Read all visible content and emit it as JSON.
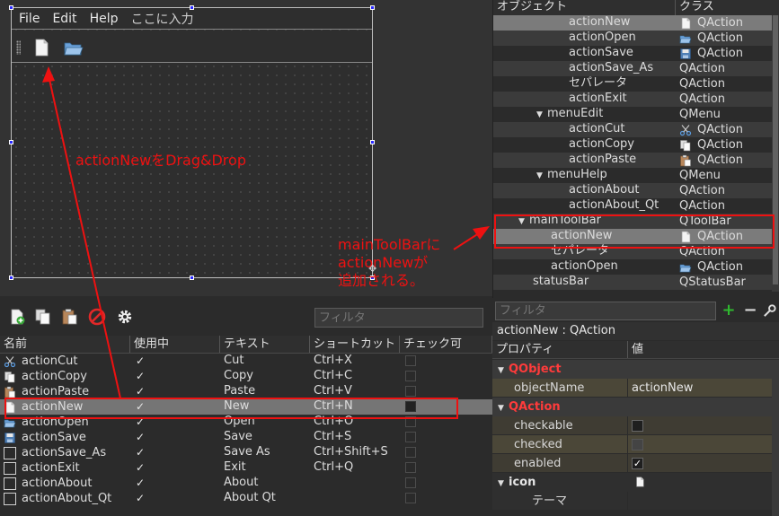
{
  "form": {
    "menus": [
      "File",
      "Edit",
      "Help",
      "ここに入力"
    ]
  },
  "action_editor": {
    "filter_placeholder": "フィルタ",
    "columns": [
      "名前",
      "使用中",
      "テキスト",
      "ショートカット",
      "チェック可"
    ],
    "rows": [
      {
        "name": "actionCut",
        "used": "✓",
        "text": "Cut",
        "shortcut": "Ctrl+X",
        "icon": "cut-icon"
      },
      {
        "name": "actionCopy",
        "used": "✓",
        "text": "Copy",
        "shortcut": "Ctrl+C",
        "icon": "copy-icon"
      },
      {
        "name": "actionPaste",
        "used": "✓",
        "text": "Paste",
        "shortcut": "Ctrl+V",
        "icon": "paste-icon"
      },
      {
        "name": "actionNew",
        "used": "✓",
        "text": "New",
        "shortcut": "Ctrl+N",
        "icon": "new-file-icon"
      },
      {
        "name": "actionOpen",
        "used": "✓",
        "text": "Open",
        "shortcut": "Ctrl+O",
        "icon": "open-folder-icon"
      },
      {
        "name": "actionSave",
        "used": "✓",
        "text": "Save",
        "shortcut": "Ctrl+S",
        "icon": "save-icon"
      },
      {
        "name": "actionSave_As",
        "used": "✓",
        "text": "Save As",
        "shortcut": "Ctrl+Shift+S",
        "icon": "blank-icon"
      },
      {
        "name": "actionExit",
        "used": "✓",
        "text": "Exit",
        "shortcut": "Ctrl+Q",
        "icon": "blank-icon"
      },
      {
        "name": "actionAbout",
        "used": "✓",
        "text": "About",
        "shortcut": "",
        "icon": "blank-icon"
      },
      {
        "name": "actionAbout_Qt",
        "used": "✓",
        "text": "About Qt",
        "shortcut": "",
        "icon": "blank-icon"
      }
    ]
  },
  "object_inspector": {
    "columns": [
      "オブジェクト",
      "クラス"
    ],
    "rows": [
      {
        "name": "actionNew",
        "class": "QAction",
        "icon": "new-file-icon"
      },
      {
        "name": "actionOpen",
        "class": "QAction",
        "icon": "open-folder-icon"
      },
      {
        "name": "actionSave",
        "class": "QAction",
        "icon": "save-icon"
      },
      {
        "name": "actionSave_As",
        "class": "QAction",
        "icon": ""
      },
      {
        "name": "セパレータ",
        "class": "QAction",
        "icon": ""
      },
      {
        "name": "actionExit",
        "class": "QAction",
        "icon": ""
      },
      {
        "name": "menuEdit",
        "class": "QMenu",
        "icon": ""
      },
      {
        "name": "actionCut",
        "class": "QAction",
        "icon": "cut-icon"
      },
      {
        "name": "actionCopy",
        "class": "QAction",
        "icon": "copy-icon"
      },
      {
        "name": "actionPaste",
        "class": "QAction",
        "icon": "paste-icon"
      },
      {
        "name": "menuHelp",
        "class": "QMenu",
        "icon": ""
      },
      {
        "name": "actionAbout",
        "class": "QAction",
        "icon": ""
      },
      {
        "name": "actionAbout_Qt",
        "class": "QAction",
        "icon": ""
      },
      {
        "name": "mainToolBar",
        "class": "QToolBar",
        "icon": ""
      },
      {
        "name": "actionNew",
        "class": "QAction",
        "icon": "new-file-icon"
      },
      {
        "name": "セパレータ",
        "class": "QAction",
        "icon": ""
      },
      {
        "name": "actionOpen",
        "class": "QAction",
        "icon": "open-folder-icon"
      },
      {
        "name": "statusBar",
        "class": "QStatusBar",
        "icon": ""
      }
    ]
  },
  "property_editor": {
    "filter_placeholder": "フィルタ",
    "title": "actionNew : QAction",
    "columns": [
      "プロパティ",
      "値"
    ],
    "groups": {
      "qobject": "QObject",
      "qaction": "QAction",
      "icon": "icon"
    },
    "props": {
      "objectName": {
        "label": "objectName",
        "value": "actionNew"
      },
      "checkable": {
        "label": "checkable"
      },
      "checked": {
        "label": "checked"
      },
      "enabled": {
        "label": "enabled",
        "value": "✓"
      },
      "theme": {
        "label": "テーマ"
      }
    }
  },
  "annotations": {
    "drag_note": "actionNewをDrag&Drop",
    "added_note_1": "mainToolBarに",
    "added_note_2": "actionNewが",
    "added_note_3": "追加される。"
  },
  "colors": {
    "annotation": "#ee1111",
    "selection": "#757575",
    "group_header": "#ff3b3b"
  }
}
